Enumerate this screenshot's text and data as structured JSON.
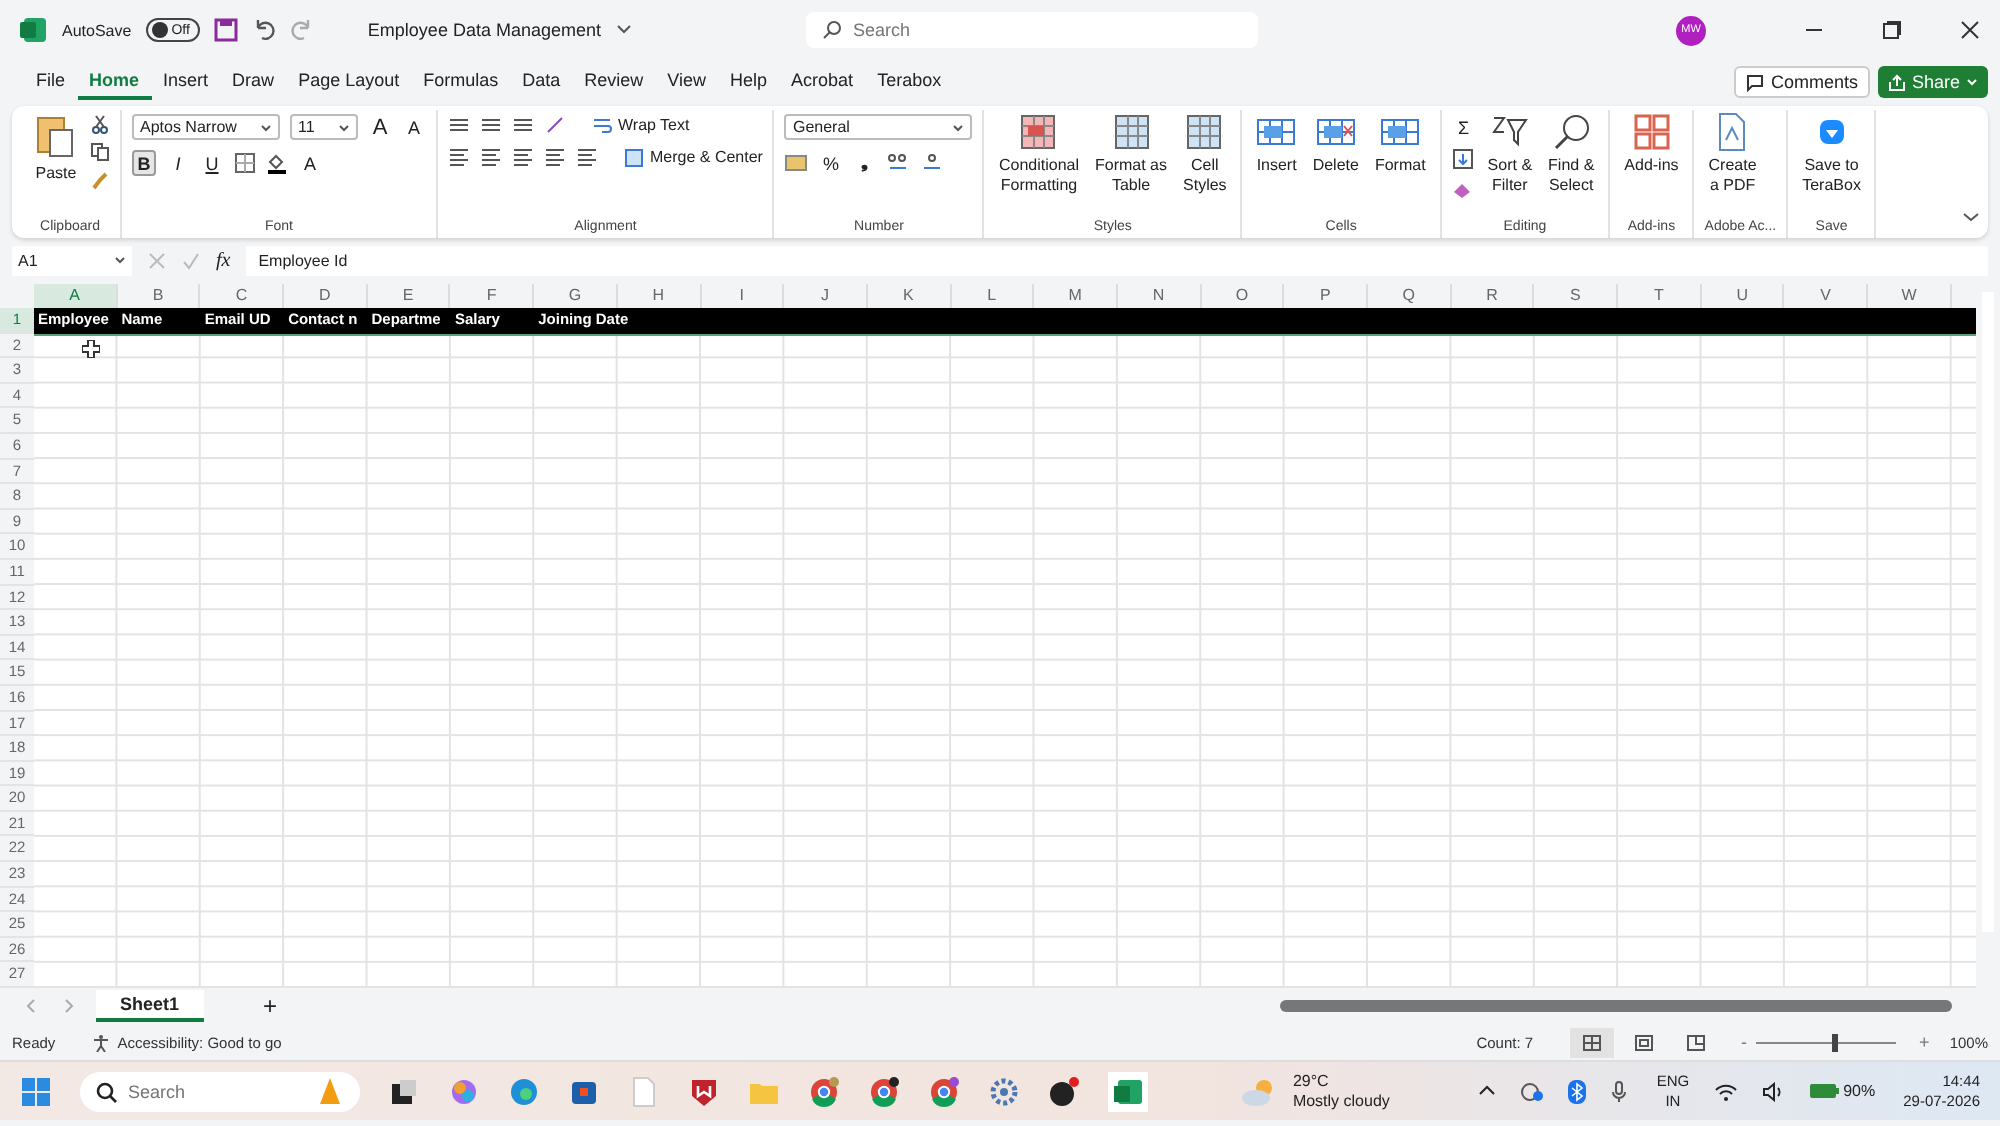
{
  "title_bar": {
    "autosave_label": "AutoSave",
    "autosave": {
      "on": false,
      "label": "Off"
    },
    "title": "Employee Data Management",
    "search": {
      "placeholder": "Search"
    },
    "avatar": "MW"
  },
  "tabs": [
    {
      "label": "File",
      "selected": false
    },
    {
      "label": "Home",
      "selected": true
    },
    {
      "label": "Insert",
      "selected": false
    },
    {
      "label": "Draw",
      "selected": false
    },
    {
      "label": "Page Layout",
      "selected": false
    },
    {
      "label": "Formulas",
      "selected": false
    },
    {
      "label": "Data",
      "selected": false
    },
    {
      "label": "Review",
      "selected": false
    },
    {
      "label": "View",
      "selected": false
    },
    {
      "label": "Help",
      "selected": false
    },
    {
      "label": "Acrobat",
      "selected": false
    },
    {
      "label": "Terabox",
      "selected": false
    }
  ],
  "comments_button": "Comments",
  "share_button": "Share",
  "ribbon": {
    "clipboard": {
      "paste": "Paste",
      "group": "Clipboard"
    },
    "font": {
      "name": "Aptos Narrow",
      "size": "11",
      "grow": "A",
      "shrink": "A",
      "bold": {
        "label": "B",
        "selected": true
      },
      "italic": {
        "label": "I",
        "selected": false
      },
      "underline": {
        "label": "U",
        "selected": false
      },
      "font_color": "A",
      "group": "Font"
    },
    "alignment": {
      "wrap": "Wrap Text",
      "merge": "Merge & Center",
      "group": "Alignment"
    },
    "number": {
      "format": "General",
      "percent": "%",
      "comma": "❟",
      "group": "Number"
    },
    "styles": {
      "items": [
        [
          "Conditional",
          "Formatting"
        ],
        [
          "Format as",
          "Table"
        ],
        [
          "Cell",
          "Styles"
        ]
      ],
      "group": "Styles"
    },
    "cells": {
      "items": [
        "Insert",
        "Delete",
        "Format"
      ],
      "group": "Cells"
    },
    "editing": {
      "sum": "Σ",
      "items": [
        [
          "Sort &",
          "Filter"
        ],
        [
          "Find &",
          "Select"
        ]
      ],
      "group": "Editing"
    },
    "addins": {
      "item": "Add-ins",
      "group": "Add-ins"
    },
    "adobe": {
      "item": [
        "Create",
        "a PDF"
      ],
      "group": "Adobe Ac..."
    },
    "save": {
      "item": [
        "Save to",
        "TeraBox"
      ],
      "group": "Save"
    }
  },
  "formula_bar": {
    "name_box": "A1",
    "fx": "fx",
    "value": "Employee Id"
  },
  "sheet": {
    "columns": [
      "A",
      "B",
      "C",
      "D",
      "E",
      "F",
      "G",
      "H",
      "I",
      "J",
      "K",
      "L",
      "M",
      "N",
      "O",
      "P",
      "Q",
      "R",
      "S",
      "T",
      "U",
      "V",
      "W"
    ],
    "rows": [
      "1",
      "2",
      "3",
      "4",
      "5",
      "6",
      "7",
      "8",
      "9",
      "10",
      "11",
      "12",
      "13",
      "14",
      "15",
      "16",
      "17",
      "18",
      "19",
      "20",
      "21",
      "22",
      "23",
      "24",
      "25",
      "26",
      "27"
    ],
    "header_cells": [
      "Employee",
      "Name",
      "Email UD",
      "Contact n",
      "Departme",
      "Salary",
      "Joining Date"
    ]
  },
  "sheet_tabs": [
    {
      "label": "Sheet1",
      "selected": true
    }
  ],
  "add_sheet": "+",
  "status_bar": {
    "ready": "Ready",
    "accessibility": "Accessibility: Good to go",
    "count": "Count: 7",
    "views": [
      {
        "selected": true
      },
      {
        "selected": false
      },
      {
        "selected": false
      }
    ],
    "zoom_minus": "-",
    "zoom_plus": "+",
    "zoom": {
      "level": 0.55
    },
    "zoom_label": "100%"
  },
  "taskbar": {
    "search": {
      "placeholder": "Search"
    },
    "temperature": "29°C",
    "weather": "Mostly cloudy",
    "lang": "ENG",
    "region": "IN",
    "battery": "90%",
    "time": "14:44",
    "date": "29-07-2026"
  }
}
